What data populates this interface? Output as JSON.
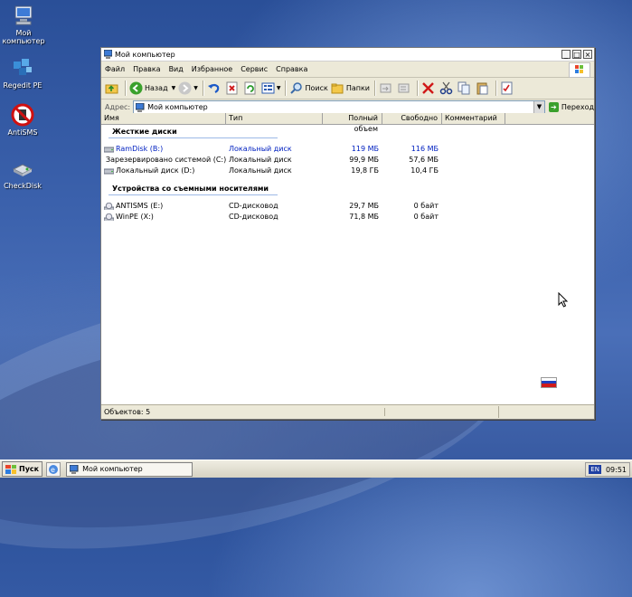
{
  "desktop": {
    "icons": [
      {
        "label": "Мой компьютер",
        "icon": "computer-icon"
      },
      {
        "label": "Regedit PE",
        "icon": "regedit-icon"
      },
      {
        "label": "AntiSMS",
        "icon": "antisms-icon"
      },
      {
        "label": "CheckDisk",
        "icon": "checkdisk-icon"
      }
    ]
  },
  "window": {
    "title": "Мой компьютер",
    "controls": {
      "minimize": "_",
      "maximize": "□",
      "close": "×"
    },
    "menu": [
      "Файл",
      "Правка",
      "Вид",
      "Избранное",
      "Сервис",
      "Справка"
    ],
    "toolbar": {
      "back": "Назад",
      "search": "Поиск",
      "folders": "Папки"
    },
    "address": {
      "label": "Адрес:",
      "value": "Мой компьютер",
      "go": "Переход"
    },
    "columns": [
      "Имя",
      "Тип",
      "Полный объем",
      "Свободно",
      "Комментарий"
    ],
    "groups": [
      {
        "title": "Жесткие диски",
        "items": [
          {
            "name": "RamDisk (B:)",
            "type": "Локальный диск",
            "total": "119 МБ",
            "free": "116 МБ",
            "selected": true
          },
          {
            "name": "Зарезервировано системой (C:)",
            "type": "Локальный диск",
            "total": "99,9 МБ",
            "free": "57,6 МБ",
            "selected": false
          },
          {
            "name": "Локальный диск (D:)",
            "type": "Локальный диск",
            "total": "19,8 ГБ",
            "free": "10,4 ГБ",
            "selected": false
          }
        ]
      },
      {
        "title": "Устройства со съемными носителями",
        "items": [
          {
            "name": "ANTISMS (E:)",
            "type": "CD-дисковод",
            "total": "29,7 МБ",
            "free": "0 байт",
            "selected": false
          },
          {
            "name": "WinPE (X:)",
            "type": "CD-дисковод",
            "total": "71,8 МБ",
            "free": "0 байт",
            "selected": false
          }
        ]
      }
    ],
    "status": "Объектов: 5"
  },
  "taskbar": {
    "start": "Пуск",
    "task": "Мой компьютер",
    "lang": "EN",
    "time": "09:51"
  },
  "colors": {
    "selection_text": "#0020c0",
    "desktop": "#3c62ad",
    "group_line": "#9db9e6"
  }
}
